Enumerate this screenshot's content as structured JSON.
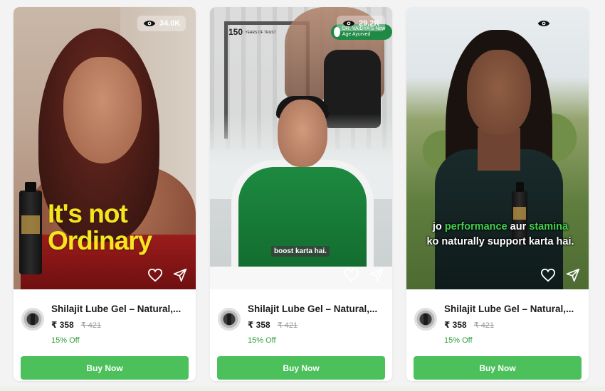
{
  "cards": [
    {
      "views": "34.0K",
      "overlay_line1": "It's not",
      "overlay_line2": "Ordinary",
      "title": "Shilajit Lube Gel – Natural,...",
      "price": "₹ 358",
      "mrp": "₹ 421",
      "discount": "15% Off",
      "buy_label": "Buy Now"
    },
    {
      "views": "29.2K",
      "brand_years": "150",
      "brand_years_sub": "YEARS OF TRUST",
      "badge_text": "DR. VAIDYA'S New Age Ayurved",
      "caption": "boost karta hai.",
      "title": "Shilajit Lube Gel – Natural,...",
      "price": "₹ 358",
      "mrp": "₹ 421",
      "discount": "15% Off",
      "buy_label": "Buy Now"
    },
    {
      "views": "",
      "caption_part1": "jo ",
      "caption_hl1": "performance",
      "caption_part2": " aur ",
      "caption_hl2": "stamina",
      "caption_line2": "ko naturally support karta hai.",
      "title": "Shilajit Lube Gel – Natural,...",
      "price": "₹ 358",
      "mrp": "₹ 421",
      "discount": "15% Off",
      "buy_label": "Buy Now"
    }
  ],
  "icons": {
    "views": "eye-icon",
    "like": "heart-icon",
    "share": "share-icon"
  },
  "colors": {
    "buy_button": "#4cc05b",
    "discount": "#2e9e3b",
    "overlay_text": "#f5e51d",
    "caption_highlight": "#43d14f"
  }
}
